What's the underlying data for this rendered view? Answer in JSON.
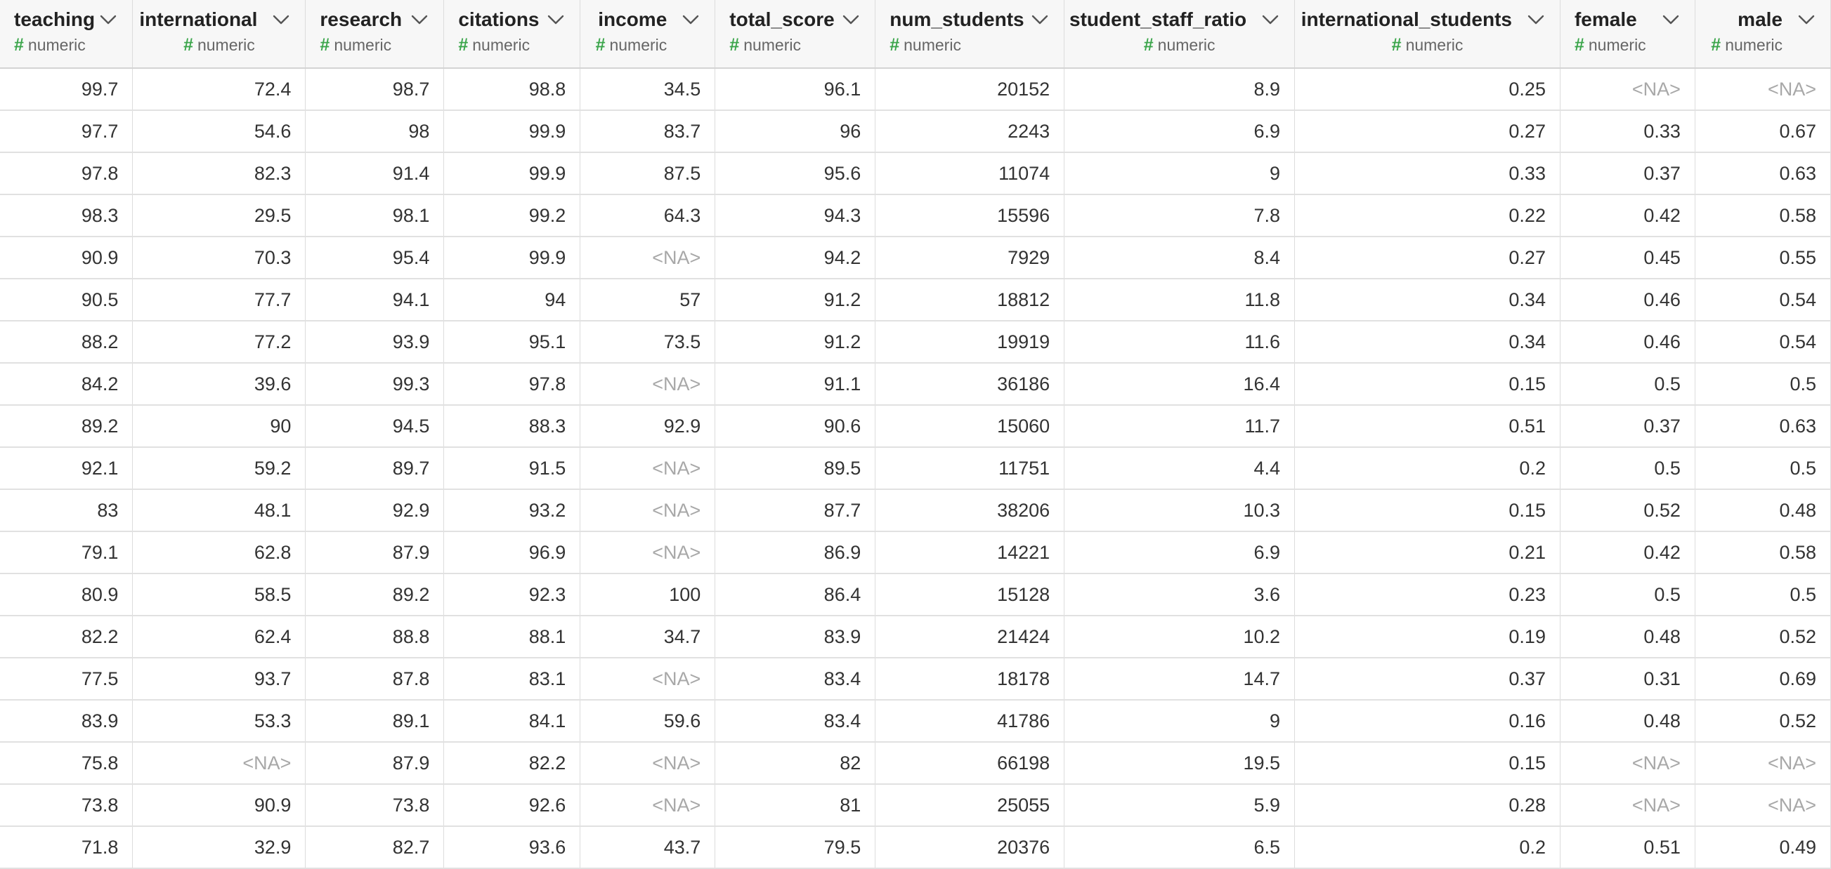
{
  "columns": [
    {
      "name": "teaching",
      "type": "numeric"
    },
    {
      "name": "international",
      "type": "numeric"
    },
    {
      "name": "research",
      "type": "numeric"
    },
    {
      "name": "citations",
      "type": "numeric"
    },
    {
      "name": "income",
      "type": "numeric"
    },
    {
      "name": "total_score",
      "type": "numeric"
    },
    {
      "name": "num_students",
      "type": "numeric"
    },
    {
      "name": "student_staff_ratio",
      "type": "numeric"
    },
    {
      "name": "international_students",
      "type": "numeric"
    },
    {
      "name": "female",
      "type": "numeric"
    },
    {
      "name": "male",
      "type": "numeric"
    }
  ],
  "type_icon": "#",
  "dropdown_icon": "chevron-down-icon",
  "na_text": "<NA>",
  "colors": {
    "type_hash": "#3aa54a",
    "na": "#a8a8a8",
    "header_bg": "#f7f7f7"
  },
  "rows": [
    [
      "99.7",
      "72.4",
      "98.7",
      "98.8",
      "34.5",
      "96.1",
      "20152",
      "8.9",
      "0.25",
      "<NA>",
      "<NA>"
    ],
    [
      "97.7",
      "54.6",
      "98",
      "99.9",
      "83.7",
      "96",
      "2243",
      "6.9",
      "0.27",
      "0.33",
      "0.67"
    ],
    [
      "97.8",
      "82.3",
      "91.4",
      "99.9",
      "87.5",
      "95.6",
      "11074",
      "9",
      "0.33",
      "0.37",
      "0.63"
    ],
    [
      "98.3",
      "29.5",
      "98.1",
      "99.2",
      "64.3",
      "94.3",
      "15596",
      "7.8",
      "0.22",
      "0.42",
      "0.58"
    ],
    [
      "90.9",
      "70.3",
      "95.4",
      "99.9",
      "<NA>",
      "94.2",
      "7929",
      "8.4",
      "0.27",
      "0.45",
      "0.55"
    ],
    [
      "90.5",
      "77.7",
      "94.1",
      "94",
      "57",
      "91.2",
      "18812",
      "11.8",
      "0.34",
      "0.46",
      "0.54"
    ],
    [
      "88.2",
      "77.2",
      "93.9",
      "95.1",
      "73.5",
      "91.2",
      "19919",
      "11.6",
      "0.34",
      "0.46",
      "0.54"
    ],
    [
      "84.2",
      "39.6",
      "99.3",
      "97.8",
      "<NA>",
      "91.1",
      "36186",
      "16.4",
      "0.15",
      "0.5",
      "0.5"
    ],
    [
      "89.2",
      "90",
      "94.5",
      "88.3",
      "92.9",
      "90.6",
      "15060",
      "11.7",
      "0.51",
      "0.37",
      "0.63"
    ],
    [
      "92.1",
      "59.2",
      "89.7",
      "91.5",
      "<NA>",
      "89.5",
      "11751",
      "4.4",
      "0.2",
      "0.5",
      "0.5"
    ],
    [
      "83",
      "48.1",
      "92.9",
      "93.2",
      "<NA>",
      "87.7",
      "38206",
      "10.3",
      "0.15",
      "0.52",
      "0.48"
    ],
    [
      "79.1",
      "62.8",
      "87.9",
      "96.9",
      "<NA>",
      "86.9",
      "14221",
      "6.9",
      "0.21",
      "0.42",
      "0.58"
    ],
    [
      "80.9",
      "58.5",
      "89.2",
      "92.3",
      "100",
      "86.4",
      "15128",
      "3.6",
      "0.23",
      "0.5",
      "0.5"
    ],
    [
      "82.2",
      "62.4",
      "88.8",
      "88.1",
      "34.7",
      "83.9",
      "21424",
      "10.2",
      "0.19",
      "0.48",
      "0.52"
    ],
    [
      "77.5",
      "93.7",
      "87.8",
      "83.1",
      "<NA>",
      "83.4",
      "18178",
      "14.7",
      "0.37",
      "0.31",
      "0.69"
    ],
    [
      "83.9",
      "53.3",
      "89.1",
      "84.1",
      "59.6",
      "83.4",
      "41786",
      "9",
      "0.16",
      "0.48",
      "0.52"
    ],
    [
      "75.8",
      "<NA>",
      "87.9",
      "82.2",
      "<NA>",
      "82",
      "66198",
      "19.5",
      "0.15",
      "<NA>",
      "<NA>"
    ],
    [
      "73.8",
      "90.9",
      "73.8",
      "92.6",
      "<NA>",
      "81",
      "25055",
      "5.9",
      "0.28",
      "<NA>",
      "<NA>"
    ],
    [
      "71.8",
      "32.9",
      "82.7",
      "93.6",
      "43.7",
      "79.5",
      "20376",
      "6.5",
      "0.2",
      "0.51",
      "0.49"
    ]
  ]
}
